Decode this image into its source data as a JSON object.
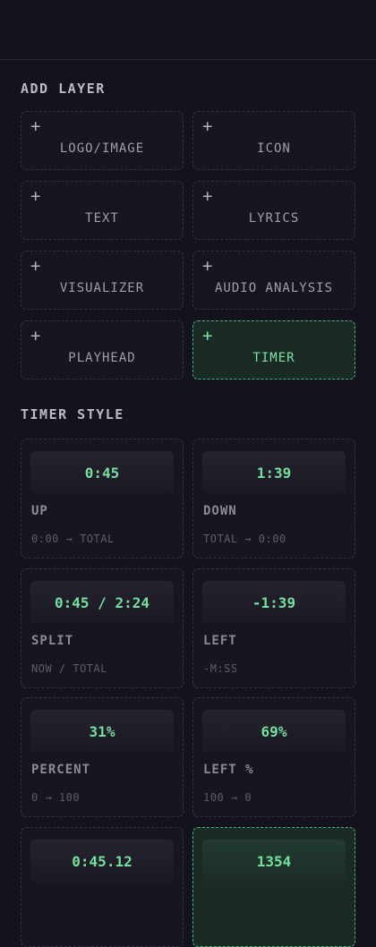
{
  "add_layer": {
    "title": "ADD LAYER",
    "items": [
      {
        "label": "LOGO/IMAGE"
      },
      {
        "label": "ICON"
      },
      {
        "label": "TEXT"
      },
      {
        "label": "LYRICS"
      },
      {
        "label": "VISUALIZER"
      },
      {
        "label": "AUDIO ANALYSIS"
      },
      {
        "label": "PLAYHEAD"
      },
      {
        "label": "TIMER",
        "selected": true
      }
    ]
  },
  "timer_style": {
    "title": "TIMER STYLE",
    "items": [
      {
        "preview": "0:45",
        "name": "UP",
        "desc": "0:00 → TOTAL"
      },
      {
        "preview": "1:39",
        "name": "DOWN",
        "desc": "TOTAL → 0:00"
      },
      {
        "preview": "0:45 / 2:24",
        "name": "SPLIT",
        "desc": "NOW / TOTAL"
      },
      {
        "preview": "-1:39",
        "name": "LEFT",
        "desc": "-M:SS"
      },
      {
        "preview": "31%",
        "name": "PERCENT",
        "desc": "0 → 100"
      },
      {
        "preview": "69%",
        "name": "LEFT %",
        "desc": "100 → 0"
      },
      {
        "preview": "0:45.12",
        "name": "",
        "desc": ""
      },
      {
        "preview": "1354",
        "name": "",
        "desc": "",
        "selected": true
      }
    ]
  },
  "icons": {
    "plus": "+",
    "arrow": "→"
  },
  "colors": {
    "background": "#14121d",
    "accent": "#72e09d",
    "selected_border": "#46b27c",
    "selected_bg": "#1a2a24"
  }
}
